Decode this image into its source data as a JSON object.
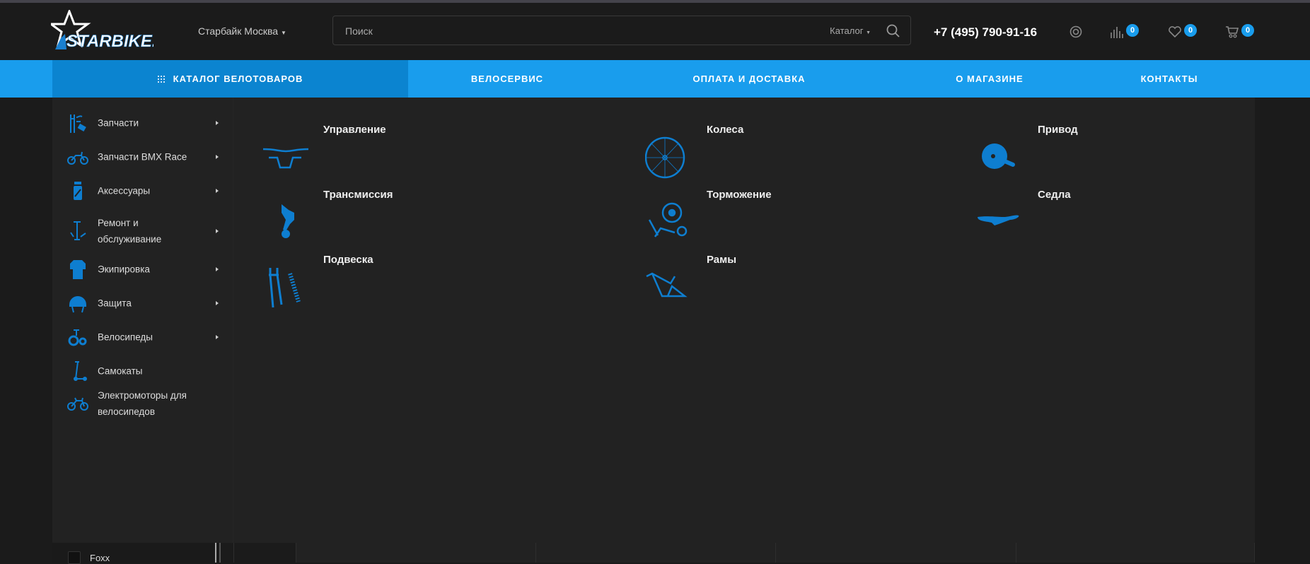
{
  "header": {
    "logo_text": "StarBike.ru",
    "city": "Старбайк Москва",
    "search_placeholder": "Поиск",
    "search_scope": "Каталог",
    "phone": "+7 (495) 790-91-16",
    "compare_count": "0",
    "favorites_count": "0",
    "cart_count": "0"
  },
  "nav": {
    "catalog": "КАТАЛОГ ВЕЛОТОВАРОВ",
    "items": [
      "ВЕЛОСЕРВИС",
      "ОПЛАТА И ДОСТАВКА",
      "О МАГАЗИНЕ",
      "КОНТАКТЫ"
    ]
  },
  "menu": [
    {
      "label": "Запчасти",
      "icon": "fork-parts-icon",
      "has_sub": true
    },
    {
      "label": "Запчасти BMX Race",
      "icon": "bmx-icon",
      "has_sub": true
    },
    {
      "label": "Аксессуары",
      "icon": "bottle-icon",
      "has_sub": true
    },
    {
      "label": "Ремонт и обслуживание",
      "icon": "pump-icon",
      "has_sub": true
    },
    {
      "label": "Экипировка",
      "icon": "jersey-icon",
      "has_sub": true
    },
    {
      "label": "Защита",
      "icon": "helmet-icon",
      "has_sub": true
    },
    {
      "label": "Велосипеды",
      "icon": "kids-bike-icon",
      "has_sub": true
    },
    {
      "label": "Самокаты",
      "icon": "scooter-icon",
      "has_sub": false
    },
    {
      "label": "Электромоторы для велосипедов",
      "icon": "ebike-icon",
      "has_sub": false
    }
  ],
  "subcategories": [
    {
      "label": "Управление",
      "icon": "handlebar-icon"
    },
    {
      "label": "Колеса",
      "icon": "wheel-icon"
    },
    {
      "label": "Привод",
      "icon": "crankset-icon"
    },
    {
      "label": "Трансмиссия",
      "icon": "derailleur-icon"
    },
    {
      "label": "Торможение",
      "icon": "brake-icon"
    },
    {
      "label": "Седла",
      "icon": "saddle-icon"
    },
    {
      "label": "Подвеска",
      "icon": "suspension-icon"
    },
    {
      "label": "Рамы",
      "icon": "frame-icon"
    }
  ],
  "filter": {
    "brand": "Foxx"
  },
  "colors": {
    "accent": "#199ded",
    "accent_dark": "#0b84d0",
    "icon": "#0e7ed0"
  }
}
